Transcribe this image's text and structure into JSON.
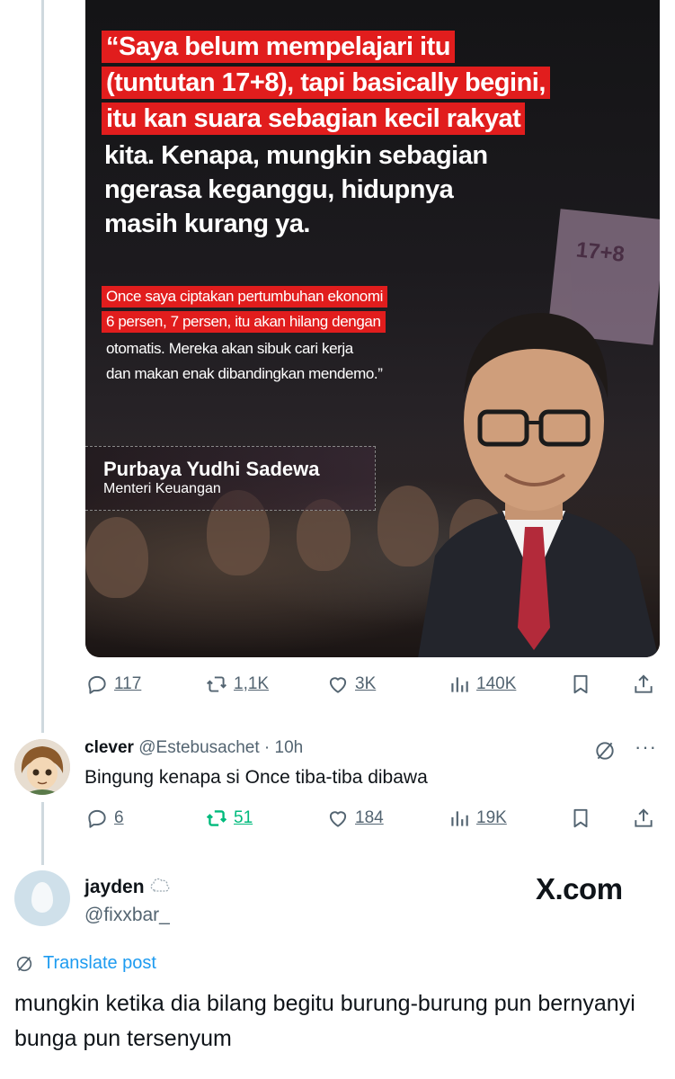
{
  "card": {
    "quote_highlight": [
      "“Saya belum mempelajari itu",
      "(tuntutan 17+8), tapi basically begini,",
      "itu kan suara sebagian kecil rakyat"
    ],
    "quote_white": [
      "kita. Kenapa, mungkin sebagian",
      "ngerasa keganggu, hidupnya",
      "masih kurang ya."
    ],
    "sub_highlight": [
      "Once saya ciptakan pertumbuhan ekonomi",
      "6 persen, 7 persen, itu akan hilang dengan"
    ],
    "sub_white": [
      "otomatis. Mereka akan sibuk cari kerja",
      "dan makan enak dibandingkan mendemo.”"
    ],
    "sign_text": "17+8",
    "person_name": "Purbaya Yudhi Sadewa",
    "person_title": "Menteri Keuangan"
  },
  "post_actions": {
    "replies": "117",
    "reposts": "1,1K",
    "likes": "3K",
    "views": "140K"
  },
  "reply": {
    "display_name": "clever",
    "handle_time": "@Estebusachet · 10h",
    "text": "Bingung kenapa si Once tiba-tiba dibawa",
    "more": "···",
    "actions": {
      "replies": "6",
      "reposts": "51",
      "likes": "184",
      "views": "19K"
    }
  },
  "bottom_post": {
    "display_name": "jayden",
    "handle": "@fixxbar_",
    "watermark": "X.com",
    "translate_label": "Translate post",
    "text": "mungkin ketika dia bilang begitu burung-burung pun bernyanyi bunga pun tersenyum"
  },
  "colors": {
    "accent_blue": "#1d9bf0",
    "repost_green": "#00ba7c",
    "muted": "#536471",
    "highlight_red": "#e11d1d"
  }
}
